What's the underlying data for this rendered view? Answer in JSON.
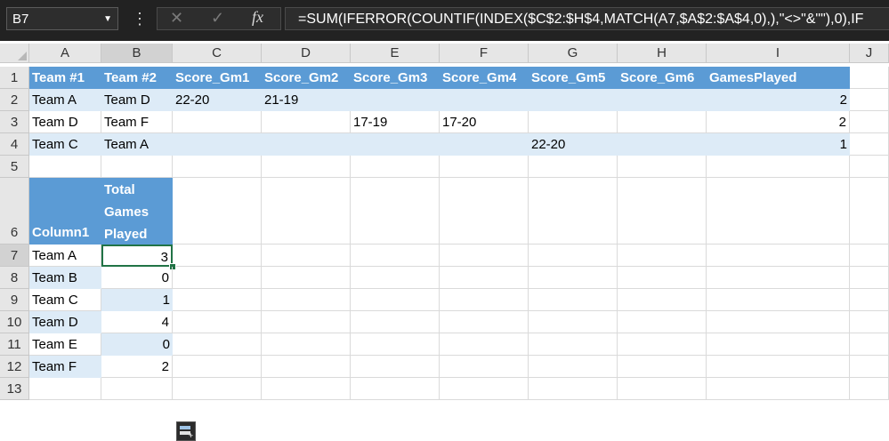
{
  "formula_bar": {
    "name_box": "B7",
    "name_box_icon": "chevron-down-icon",
    "menu_icon": "more-vertical-icon",
    "cancel_icon": "cancel-x-icon",
    "enter_icon": "enter-check-icon",
    "fx_label": "fx",
    "formula": "=SUM(IFERROR(COUNTIF(INDEX($C$2:$H$4,MATCH(A7,$A$2:$A$4,0),),\"<>\"&\"\"),0),IF"
  },
  "columns": [
    "A",
    "B",
    "C",
    "D",
    "E",
    "F",
    "G",
    "H",
    "I",
    "J"
  ],
  "rows": [
    "1",
    "2",
    "3",
    "4",
    "5",
    "6",
    "7",
    "8",
    "9",
    "10",
    "11",
    "12",
    "13"
  ],
  "table1": {
    "headers": [
      "Team #1",
      "Team #2",
      "Score_Gm1",
      "Score_Gm2",
      "Score_Gm3",
      "Score_Gm4",
      "Score_Gm5",
      "Score_Gm6",
      "GamesPlayed"
    ],
    "rows": [
      [
        "Team A",
        "Team D",
        "22-20",
        "21-19",
        "",
        "",
        "",
        "",
        "2"
      ],
      [
        "Team D",
        "Team F",
        "",
        "",
        "17-19",
        "17-20",
        "",
        "",
        "2"
      ],
      [
        "Team C",
        "Team A",
        "",
        "",
        "",
        "",
        "22-20",
        "",
        "1"
      ]
    ]
  },
  "table2": {
    "header_a": "Column1",
    "header_b_lines": [
      "Total",
      "Games",
      "Played"
    ],
    "rows": [
      [
        "Team A",
        "3"
      ],
      [
        "Team B",
        "0"
      ],
      [
        "Team C",
        "1"
      ],
      [
        "Team D",
        "4"
      ],
      [
        "Team E",
        "0"
      ],
      [
        "Team F",
        "2"
      ]
    ]
  },
  "quick_analysis_icon": "quick-analysis-icon",
  "colors": {
    "header_fill": "#5b9bd5",
    "band_fill": "#ddebf7",
    "selection_border": "#217346",
    "formula_bar_bg": "#222222"
  }
}
